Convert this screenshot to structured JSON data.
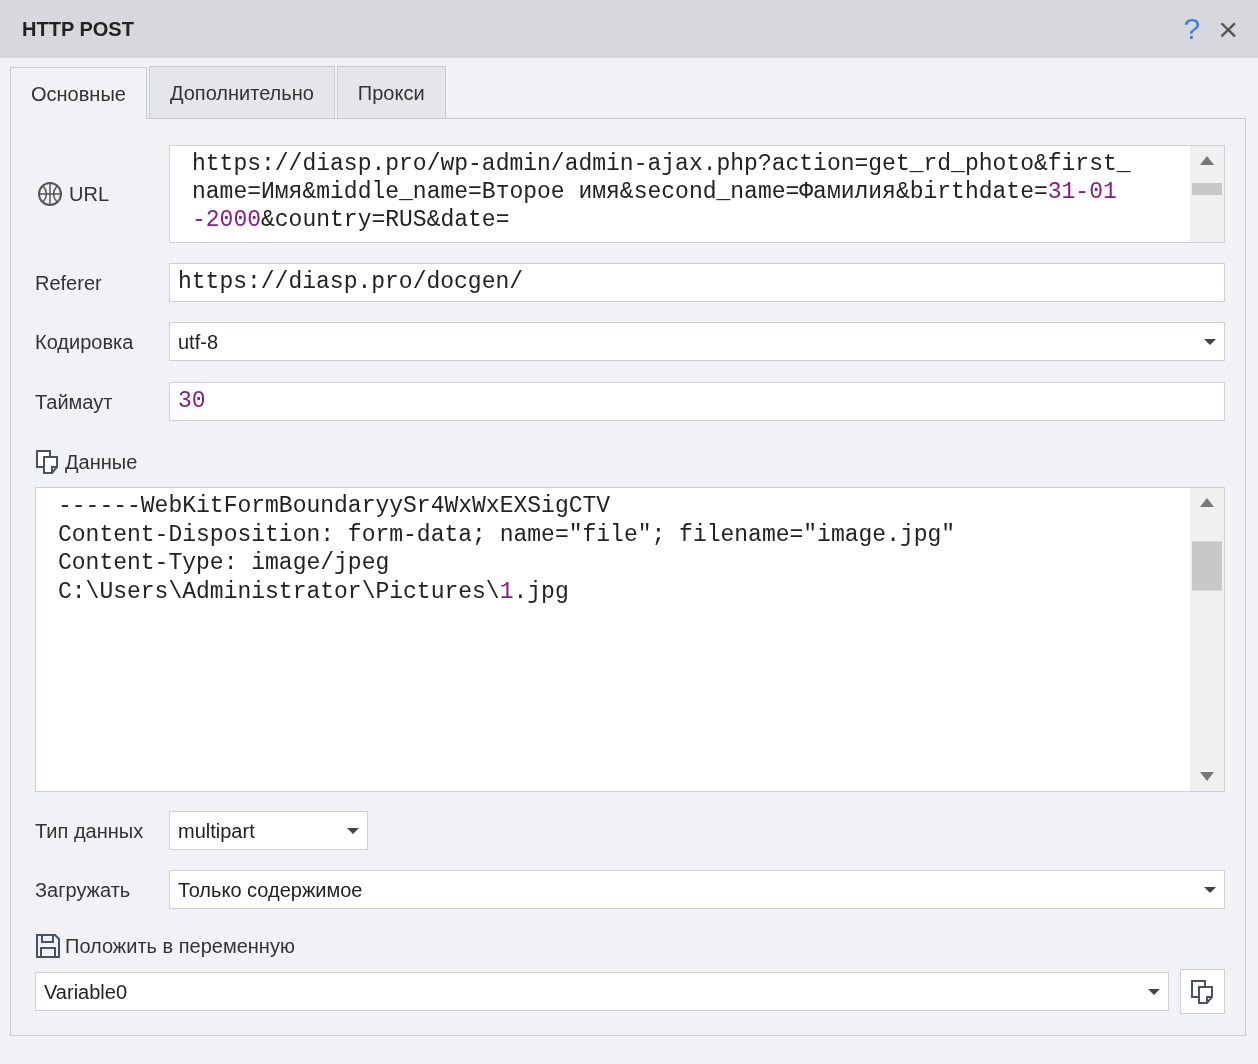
{
  "window": {
    "title": "HTTP POST",
    "help": "?",
    "close": "×"
  },
  "tabs": [
    {
      "label": "Основные",
      "selected": true
    },
    {
      "label": "Дополнительно",
      "selected": false
    },
    {
      "label": "Прокси",
      "selected": false
    }
  ],
  "fields": [
    {
      "kind": "url",
      "label": "URL",
      "segments": [
        {
          "text": "https://diasp.pro/wp-admin/admin-ajax.php?action=get_rd_photo&first_name=Имя&middle_name=Второе имя&second_name=Фамилия&birthdate=",
          "kind": "plain"
        },
        {
          "text": "31-01-2000",
          "kind": "number"
        },
        {
          "text": "&country=RUS&date=",
          "kind": "plain"
        }
      ]
    },
    {
      "kind": "text",
      "label": "Referer",
      "segments": [
        {
          "text": "https://diasp.pro/docgen/",
          "kind": "plain"
        }
      ]
    },
    {
      "kind": "select",
      "label": "Кодировка",
      "value": "utf-8"
    },
    {
      "kind": "text",
      "label": "Таймаут",
      "segments": [
        {
          "text": "30",
          "kind": "number"
        }
      ]
    },
    {
      "kind": "data",
      "label": "Данные",
      "lines": [
        [
          {
            "text": "------WebKitFormBoundaryySr4WxWxEXSigCTV",
            "kind": "plain"
          }
        ],
        [
          {
            "text": "Content-Disposition: form-data; name=\"file\"; filename=\"image.jpg\"",
            "kind": "plain"
          }
        ],
        [
          {
            "text": "Content-Type: image/jpeg",
            "kind": "plain"
          }
        ],
        [
          {
            "text": "C:\\Users\\Administrator\\Pictures\\",
            "kind": "plain"
          },
          {
            "text": "1",
            "kind": "number"
          },
          {
            "text": ".jpg",
            "kind": "plain"
          }
        ]
      ]
    },
    {
      "kind": "select-short",
      "label": "Тип данных",
      "value": "multipart"
    },
    {
      "kind": "select",
      "label": "Загружать",
      "value": "Только содержимое"
    },
    {
      "kind": "variable",
      "label": "Положить в переменную",
      "value": "Variable0"
    }
  ]
}
